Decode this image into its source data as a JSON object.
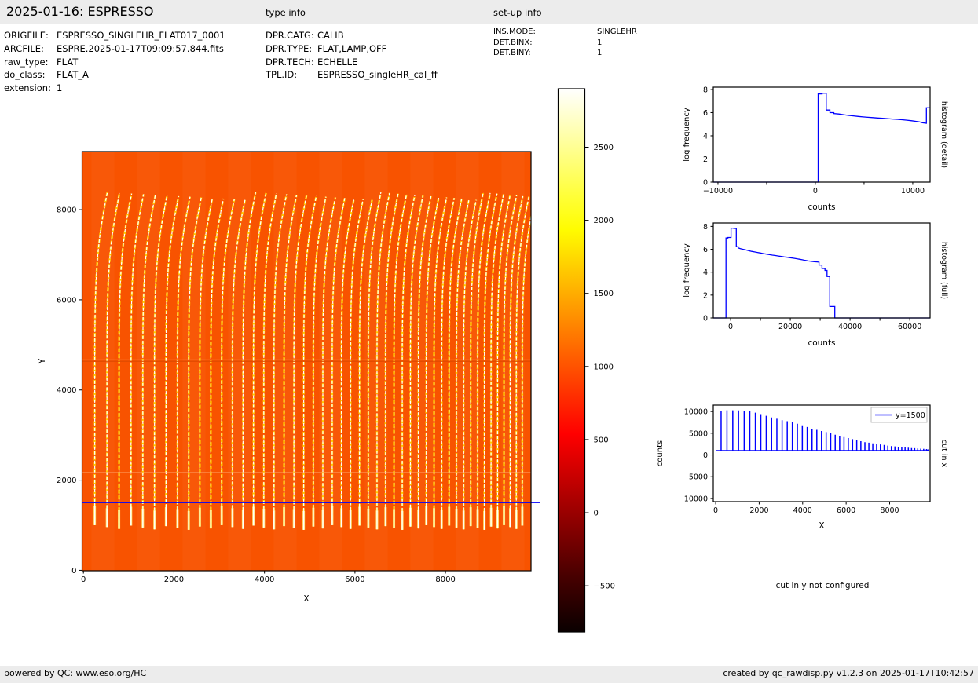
{
  "header": {
    "title": "2025-01-16: ESPRESSO",
    "type_info_label": "type info",
    "setup_info_label": "set-up info"
  },
  "file_info": {
    "rows": [
      {
        "label": "ORIGFILE:",
        "value": "ESPRESSO_SINGLEHR_FLAT017_0001"
      },
      {
        "label": "ARCFILE:",
        "value": "ESPRE.2025-01-17T09:09:57.844.fits"
      },
      {
        "label": "raw_type:",
        "value": "FLAT"
      },
      {
        "label": "do_class:",
        "value": "FLAT_A"
      },
      {
        "label": "extension:",
        "value": "1"
      }
    ]
  },
  "type_info": {
    "rows": [
      {
        "label": "DPR.CATG:",
        "value": "CALIB"
      },
      {
        "label": "DPR.TYPE:",
        "value": "FLAT,LAMP,OFF"
      },
      {
        "label": "DPR.TECH:",
        "value": "ECHELLE"
      },
      {
        "label": "TPL.ID:",
        "value": "ESPRESSO_singleHR_cal_ff"
      }
    ]
  },
  "setup_info": {
    "rows": [
      {
        "label": "INS.MODE:",
        "value": "SINGLEHR"
      },
      {
        "label": "DET.BINX:",
        "value": "1"
      },
      {
        "label": "DET.BINY:",
        "value": "1"
      }
    ]
  },
  "messages": {
    "cut_in_y": "cut in y not configured"
  },
  "footer": {
    "left": "powered by QC: www.eso.org/HC",
    "right": "created by qc_rawdisp.py v1.2.3 on 2025-01-17T10:42:57"
  },
  "colors": {
    "line_blue": "#0000ff",
    "image_orange": "#f85300",
    "stripe_yellow": "#ffd400",
    "stripe_white": "#ffffff",
    "tip_glow": "#ffe97a",
    "gap_light": "#ffab72",
    "gap_dark": "#e04b00",
    "bar_gray": "#ececec"
  },
  "chart_data": [
    {
      "id": "raw-image",
      "type": "heatmap",
      "xlabel": "X",
      "ylabel": "Y",
      "xlim": [
        -30,
        9890
      ],
      "ylim": [
        -10,
        9290
      ],
      "x_tick_values": [
        0,
        2000,
        4000,
        6000,
        8000
      ],
      "x_tick_labels": [
        "0",
        "2000",
        "4000",
        "6000",
        "8000"
      ],
      "y_tick_values": [
        0,
        2000,
        4000,
        6000,
        8000
      ],
      "y_tick_labels": [
        "0",
        "2000",
        "4000",
        "6000",
        "8000"
      ],
      "background_counts": 1000,
      "orders_y_range": [
        950,
        8300
      ],
      "detector_gap_y": 4650,
      "faint_line_y": 2170,
      "cut_line_y": 1500,
      "colorbar": {
        "colormap": "hot",
        "vmin": -816,
        "vmax": 2900,
        "tick_values": [
          -500,
          0,
          500,
          1000,
          1500,
          2000,
          2500
        ],
        "tick_labels": [
          "−500",
          "0",
          "500",
          "1000",
          "1500",
          "2000",
          "2500"
        ]
      }
    },
    {
      "id": "histogram-detail",
      "type": "line",
      "xlabel": "counts",
      "ylabel": "log frequency",
      "side_label": "histogram (detail)",
      "xlim": [
        -10480,
        11780
      ],
      "ylim": [
        0,
        8.2
      ],
      "x_tick_values": [
        -10000,
        -5000,
        0,
        5000,
        10000
      ],
      "x_tick_labels": [
        "−10000",
        "",
        "0",
        "",
        "10000"
      ],
      "y_tick_values": [
        0,
        2,
        4,
        6,
        8
      ],
      "y_tick_labels": [
        "0",
        "2",
        "4",
        "6",
        "8"
      ],
      "points": [
        [
          -10480,
          0
        ],
        [
          290,
          0
        ],
        [
          290,
          7.62
        ],
        [
          700,
          7.62
        ],
        [
          700,
          7.68
        ],
        [
          1120,
          7.68
        ],
        [
          1120,
          6.22
        ],
        [
          1500,
          6.22
        ],
        [
          1500,
          6.0
        ],
        [
          1900,
          6.0
        ],
        [
          1900,
          5.92
        ],
        [
          2400,
          5.88
        ],
        [
          2900,
          5.82
        ],
        [
          3400,
          5.76
        ],
        [
          3900,
          5.72
        ],
        [
          4400,
          5.67
        ],
        [
          4900,
          5.63
        ],
        [
          5400,
          5.6
        ],
        [
          5900,
          5.57
        ],
        [
          6400,
          5.54
        ],
        [
          6900,
          5.51
        ],
        [
          7400,
          5.48
        ],
        [
          7900,
          5.45
        ],
        [
          8400,
          5.42
        ],
        [
          8900,
          5.39
        ],
        [
          9400,
          5.35
        ],
        [
          9900,
          5.3
        ],
        [
          10300,
          5.25
        ],
        [
          10700,
          5.2
        ],
        [
          11000,
          5.12
        ],
        [
          11400,
          5.08
        ],
        [
          11400,
          6.42
        ],
        [
          11780,
          6.42
        ]
      ]
    },
    {
      "id": "histogram-full",
      "type": "line",
      "xlabel": "counts",
      "ylabel": "log frequency",
      "side_label": "histogram (full)",
      "xlim": [
        -5800,
        66800
      ],
      "ylim": [
        0,
        8.3
      ],
      "x_tick_values": [
        0,
        10000,
        20000,
        30000,
        40000,
        50000,
        60000
      ],
      "x_tick_labels": [
        "0",
        "",
        "20000",
        "",
        "40000",
        "",
        "60000"
      ],
      "y_tick_values": [
        0,
        2,
        4,
        6,
        8
      ],
      "y_tick_labels": [
        "0",
        "2",
        "4",
        "6",
        "8"
      ],
      "points": [
        [
          -5800,
          0
        ],
        [
          -1550,
          0
        ],
        [
          -1550,
          6.98
        ],
        [
          -900,
          6.98
        ],
        [
          -900,
          7.03
        ],
        [
          150,
          7.03
        ],
        [
          150,
          7.85
        ],
        [
          1100,
          7.85
        ],
        [
          1100,
          7.82
        ],
        [
          1900,
          7.82
        ],
        [
          1900,
          6.22
        ],
        [
          2500,
          6.22
        ],
        [
          2500,
          6.12
        ],
        [
          3300,
          6.05
        ],
        [
          4100,
          6.0
        ],
        [
          5000,
          5.95
        ],
        [
          6000,
          5.88
        ],
        [
          7000,
          5.82
        ],
        [
          8000,
          5.77
        ],
        [
          9000,
          5.72
        ],
        [
          10000,
          5.67
        ],
        [
          11000,
          5.62
        ],
        [
          12000,
          5.58
        ],
        [
          13000,
          5.53
        ],
        [
          14000,
          5.49
        ],
        [
          15000,
          5.45
        ],
        [
          16000,
          5.41
        ],
        [
          17000,
          5.37
        ],
        [
          18000,
          5.33
        ],
        [
          19000,
          5.3
        ],
        [
          20000,
          5.26
        ],
        [
          21000,
          5.22
        ],
        [
          22000,
          5.18
        ],
        [
          23000,
          5.13
        ],
        [
          24000,
          5.08
        ],
        [
          25000,
          5.03
        ],
        [
          26000,
          4.98
        ],
        [
          27000,
          4.95
        ],
        [
          28000,
          4.92
        ],
        [
          29000,
          4.9
        ],
        [
          29600,
          4.88
        ],
        [
          29600,
          4.62
        ],
        [
          30600,
          4.62
        ],
        [
          30600,
          4.32
        ],
        [
          31600,
          4.32
        ],
        [
          31600,
          4.15
        ],
        [
          32300,
          4.15
        ],
        [
          32300,
          3.62
        ],
        [
          33200,
          3.62
        ],
        [
          33200,
          1.0
        ],
        [
          34900,
          1.0
        ],
        [
          34900,
          0
        ],
        [
          66800,
          0
        ]
      ]
    },
    {
      "id": "cut-in-x",
      "type": "line",
      "xlabel": "X",
      "ylabel": "counts",
      "side_label": "cut in x",
      "legend": "y=1500",
      "xlim": [
        -110,
        9860
      ],
      "ylim": [
        -10740,
        11470
      ],
      "x_tick_values": [
        0,
        2000,
        4000,
        6000,
        8000
      ],
      "x_tick_labels": [
        "0",
        "2000",
        "4000",
        "6000",
        "8000"
      ],
      "y_tick_values": [
        -10000,
        -5000,
        0,
        5000,
        10000
      ],
      "y_tick_labels": [
        "−10000",
        "−5000",
        "0",
        "5000",
        "10000"
      ],
      "baseline_counts": 1000,
      "x": [
        250,
        520,
        787,
        1051,
        1312,
        1570,
        1825,
        2077,
        2326,
        2572,
        2815,
        3055,
        3292,
        3526,
        3757,
        3985,
        4210,
        4432,
        4651,
        4867,
        5080,
        5290,
        5497,
        5701,
        5902,
        6100,
        6295,
        6487,
        6676,
        6862,
        7045,
        7225,
        7402,
        7576,
        7747,
        7915,
        8080,
        8242,
        8401,
        8557,
        8710,
        8860,
        9007,
        9151,
        9292,
        9430,
        9565,
        9697
      ],
      "peak_counts": [
        10100,
        10280,
        10270,
        10240,
        10190,
        10060,
        9730,
        9390,
        9010,
        8640,
        8330,
        8000,
        7760,
        7490,
        7170,
        6820,
        6430,
        6060,
        5790,
        5520,
        5250,
        4970,
        4650,
        4370,
        4120,
        3880,
        3630,
        3390,
        3160,
        2950,
        2820,
        2680,
        2550,
        2420,
        2290,
        2160,
        2040,
        1970,
        1900,
        1820,
        1750,
        1680,
        1600,
        1550,
        1500,
        1450,
        1400,
        1350
      ]
    }
  ]
}
